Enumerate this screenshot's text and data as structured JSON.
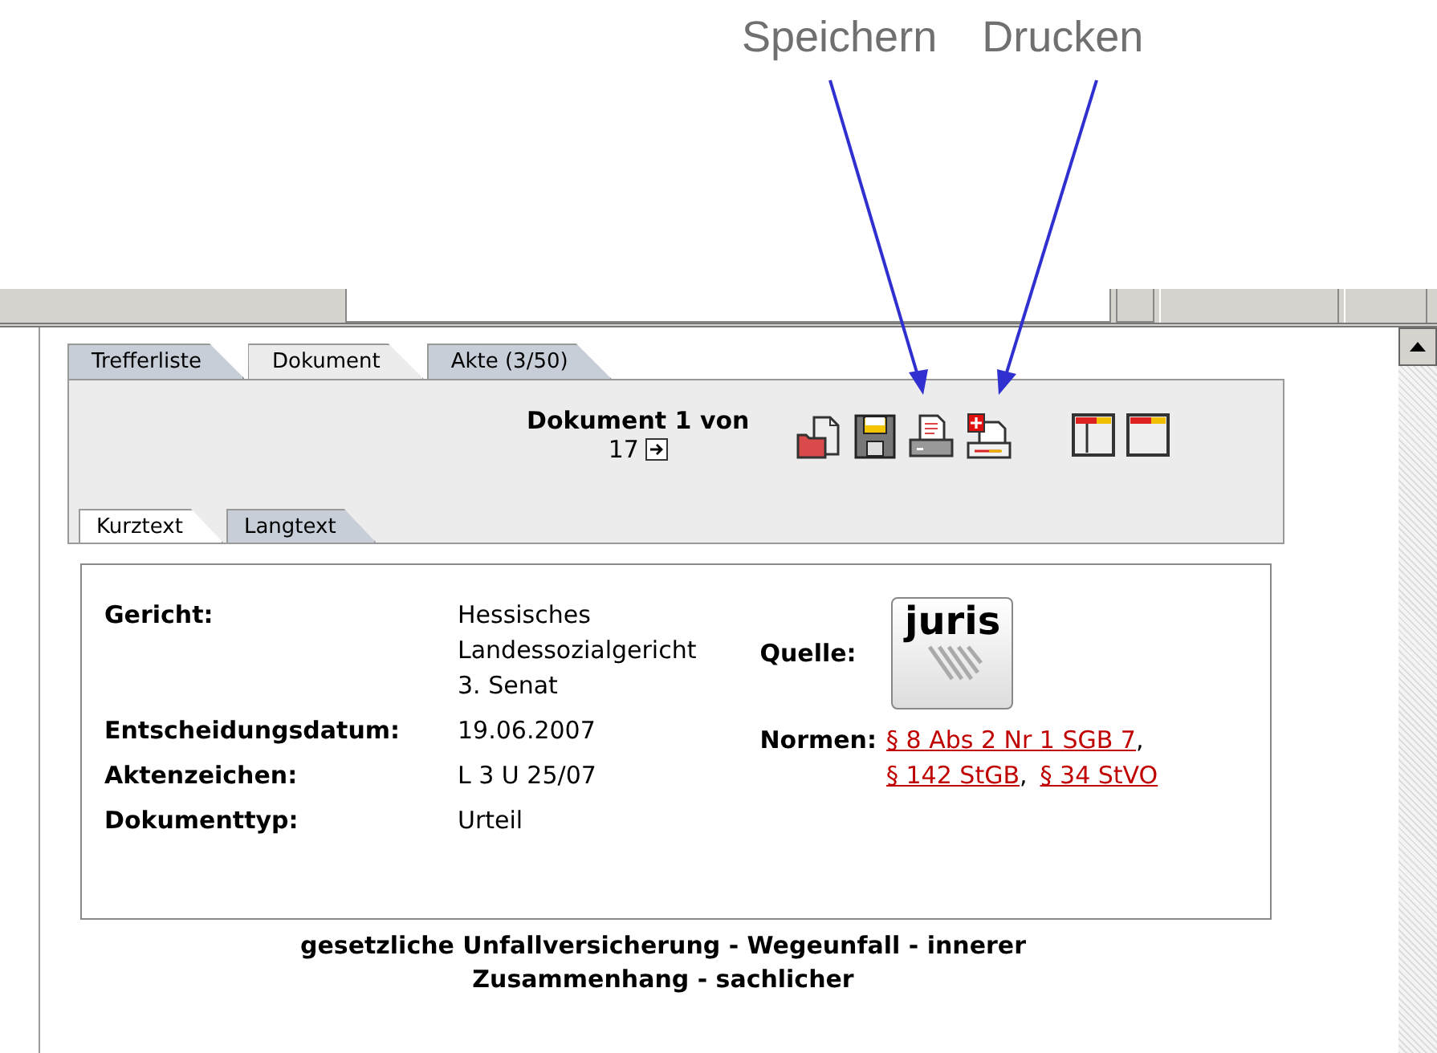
{
  "annotations": [
    {
      "label": "Speichern"
    },
    {
      "label": "Drucken"
    }
  ],
  "tabs": [
    {
      "label": "Trefferliste",
      "selected": false
    },
    {
      "label": "Dokument",
      "selected": true
    },
    {
      "label": "Akte (3/50)",
      "selected": false
    }
  ],
  "pager": {
    "text": "Dokument 1 von",
    "count": "17"
  },
  "subtabs": [
    {
      "label": "Kurztext",
      "selected": true
    },
    {
      "label": "Langtext",
      "selected": false
    }
  ],
  "fields": [
    {
      "label": "Gericht:",
      "lines": [
        "Hessisches",
        "Landessozialgericht",
        "3. Senat"
      ]
    },
    {
      "label": "Entscheidungsdatum:",
      "lines": [
        "19.06.2007"
      ]
    },
    {
      "label": "Aktenzeichen:",
      "lines": [
        "L 3 U 25/07"
      ]
    },
    {
      "label": "Dokumenttyp:",
      "lines": [
        "Urteil"
      ]
    }
  ],
  "source": {
    "label": "Quelle:",
    "logo": "juris"
  },
  "norms": {
    "label": "Normen:",
    "links": [
      {
        "text": "§ 8 Abs 2 Nr 1 SGB 7",
        "sep": ","
      },
      {
        "text": "§ 142 StGB",
        "sep": ","
      },
      {
        "text": "§ 34 StVO"
      }
    ]
  },
  "title": "gesetzliche Unfallversicherung - Wegeunfall - innerer Zusammenhang - sachlicher"
}
